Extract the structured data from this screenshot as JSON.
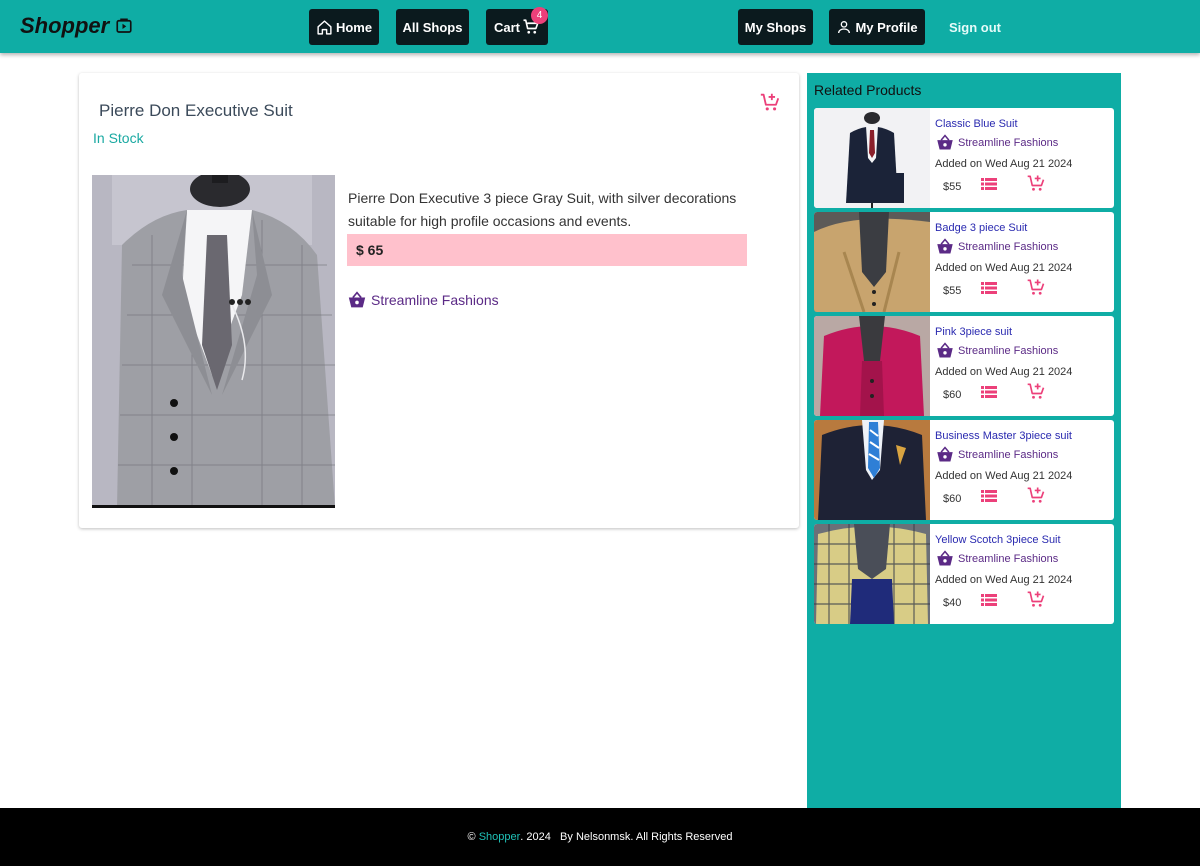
{
  "header": {
    "brand": "Shopper",
    "nav": {
      "home": "Home",
      "all_shops": "All Shops",
      "cart": "Cart",
      "cart_count": "4",
      "my_shops": "My Shops",
      "my_profile": "My Profile",
      "sign_out": "Sign out"
    }
  },
  "product": {
    "name": "Pierre Don Executive Suit",
    "stock": "In Stock",
    "description": "Pierre Don Executive 3 piece Gray Suit, with silver decorations suitable for high profile occasions and events.",
    "price": "$ 65",
    "shop": "Streamline Fashions"
  },
  "related": {
    "title": "Related Products",
    "items": [
      {
        "name": "Classic Blue Suit",
        "shop": "Streamline Fashions",
        "added": "Added on Wed Aug 21 2024",
        "price": "$55"
      },
      {
        "name": "Badge 3 piece Suit",
        "shop": "Streamline Fashions",
        "added": "Added on Wed Aug 21 2024",
        "price": "$55"
      },
      {
        "name": "Pink 3piece suit",
        "shop": "Streamline Fashions",
        "added": "Added on Wed Aug 21 2024",
        "price": "$60"
      },
      {
        "name": "Business Master 3piece suit",
        "shop": "Streamline Fashions",
        "added": "Added on Wed Aug 21 2024",
        "price": "$60"
      },
      {
        "name": "Yellow Scotch 3piece Suit",
        "shop": "Streamline Fashions",
        "added": "Added on Wed Aug 21 2024",
        "price": "$40"
      }
    ]
  },
  "footer": {
    "copyright": "©",
    "brand": "Shopper",
    "text": ". 2024   By Nelsonmsk. All Rights Reserved"
  },
  "colors": {
    "header_bg": "#0fada5",
    "accent_pink": "#ec407a",
    "price_bg": "#ffc1cc",
    "shop_purple": "#5b2a86"
  }
}
